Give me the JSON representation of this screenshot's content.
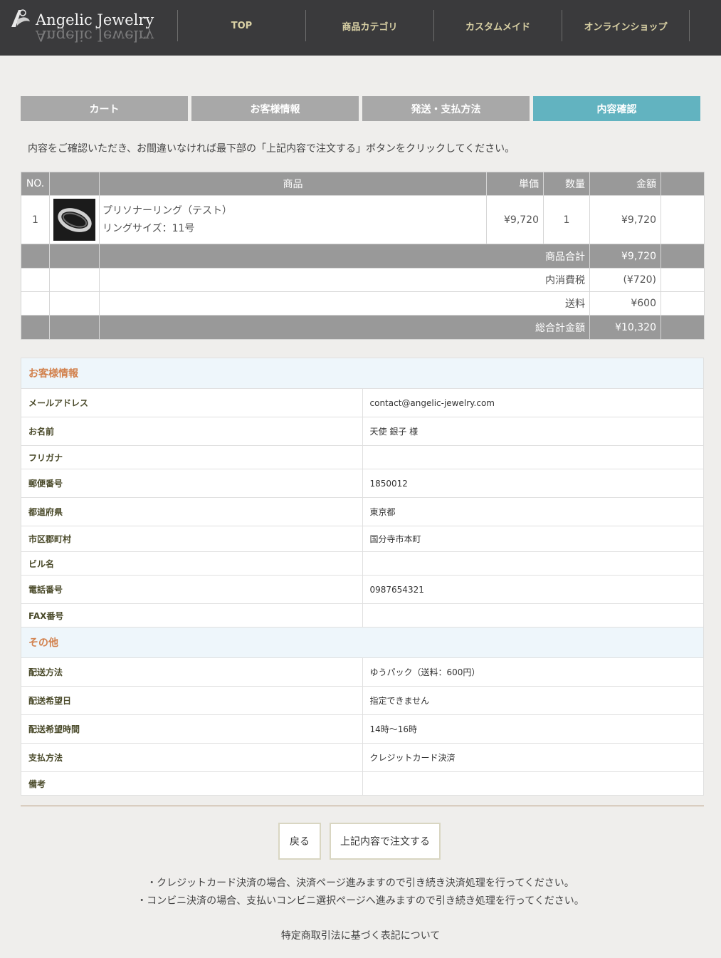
{
  "header": {
    "logo_text": "Angelic Jewelry",
    "nav": [
      "TOP",
      "商品カテゴリ",
      "カスタムメイド",
      "オンラインショップ"
    ]
  },
  "steps": [
    {
      "label": "カート",
      "active": false
    },
    {
      "label": "お客様情報",
      "active": false
    },
    {
      "label": "発送・支払方法",
      "active": false
    },
    {
      "label": "内容確認",
      "active": true
    }
  ],
  "intro": "内容をご確認いただき、お間違いなければ最下部の「上記内容で注文する」ボタンをクリックしてください。",
  "cart": {
    "headers": {
      "no": "NO.",
      "item": "商品",
      "unit_price": "単価",
      "qty": "数量",
      "amount": "金額"
    },
    "item": {
      "no": "1",
      "name": "プリソナーリング（テスト）",
      "option": "リングサイズ：11号",
      "unit_price": "¥9,720",
      "qty": "1",
      "amount": "¥9,720"
    },
    "summary": {
      "subtotal_label": "商品合計",
      "subtotal": "¥9,720",
      "tax_label": "内消費税",
      "tax": "(¥720)",
      "shipping_label": "送料",
      "shipping": "¥600",
      "total_label": "総合計金額",
      "total": "¥10,320"
    }
  },
  "customer": {
    "section_title": "お客様情報",
    "rows": [
      {
        "label": "メールアドレス",
        "value": "contact@angelic-jewelry.com"
      },
      {
        "label": "お名前",
        "value": "天使 銀子 様"
      },
      {
        "label": "フリガナ",
        "value": ""
      },
      {
        "label": "郵便番号",
        "value": "1850012"
      },
      {
        "label": "都道府県",
        "value": "東京都"
      },
      {
        "label": "市区郡町村",
        "value": "国分寺市本町"
      },
      {
        "label": "ビル名",
        "value": ""
      },
      {
        "label": "電話番号",
        "value": "0987654321"
      },
      {
        "label": "FAX番号",
        "value": ""
      }
    ]
  },
  "other": {
    "section_title": "その他",
    "rows": [
      {
        "label": "配送方法",
        "value": "ゆうパック（送料：600円）"
      },
      {
        "label": "配送希望日",
        "value": "指定できません"
      },
      {
        "label": "配送希望時間",
        "value": "14時～16時"
      },
      {
        "label": "支払方法",
        "value": "クレジットカード決済"
      },
      {
        "label": "備考",
        "value": ""
      }
    ]
  },
  "buttons": {
    "back": "戻る",
    "order": "上記内容で注文する"
  },
  "notes": [
    "・クレジットカード決済の場合、決済ページ進みますので引き続き決済処理を行ってください。",
    "・コンビニ決済の場合、支払いコンビニ選択ページへ進みますので引き続き処理を行ってください。"
  ],
  "legal_link": "特定商取引法に基づく表記について"
}
